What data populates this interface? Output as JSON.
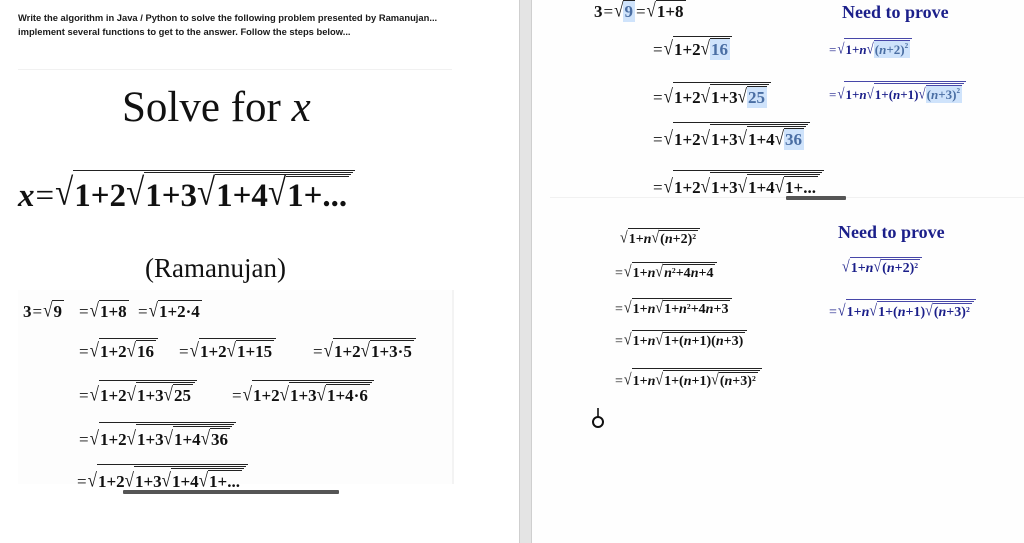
{
  "left": {
    "instructions": "Write the algorithm in Java / Python to solve the following problem presented by Ramanujan... implement several functions to get to the answer.  Follow the steps below...",
    "title_prefix": "Solve for ",
    "title_var": "x",
    "main_formula": "x = √(1 + 2√(1 + 3√(1 + 4√(1 + ...))))",
    "attribution": "(Ramanujan)",
    "derivation": [
      [
        "3=√9",
        "=√(1+8)",
        "=√(1+2·4)"
      ],
      [
        "=√(1+2√16)",
        "=√(1+2√(1+15))",
        "=√(1+2√(1+3·5))"
      ],
      [
        "=√(1+2√(1+3√25))",
        "=√(1+2√(1+3√(1+4·6)))"
      ],
      [
        "=√(1+2√(1+3√(1+4√36)))"
      ],
      [
        "=√(1+2√(1+3√(1+4√(1+...))))"
      ]
    ]
  },
  "right": {
    "top_steps": [
      "3=√[9] =√(1+8)",
      "=√(1+2√[16])",
      "=√(1+2√(1+3√[25]))",
      "=√(1+2√(1+3√(1+4√[36])))",
      "=√(1+2√(1+3√(1+4√(1+...))))"
    ],
    "heading_1": "Need to prove",
    "prove_1": [
      "=√(1+n√[(n+2)²])",
      "=√(1+n√(1+(n+1)√[(n+3)²]))"
    ],
    "bottom_steps": [
      "√(1+n√((n+2)²))",
      "=√(1+n√(n²+4n+4))",
      "=√(1+n√(1+n²+4n+3))",
      "=√(1+n√(1+(n+1)(n+3)))",
      "=√(1+n√(1+(n+1)√((n+3)²)))"
    ],
    "heading_2": "Need to prove",
    "prove_2": [
      "√(1+n√((n+2)²))",
      "=√(1+n√(1+(n+1)√((n+3)²)))"
    ]
  },
  "colors": {
    "heading": "#1b1f8a",
    "highlight": "#cfe3fb",
    "divider": "#e4e4e4"
  }
}
